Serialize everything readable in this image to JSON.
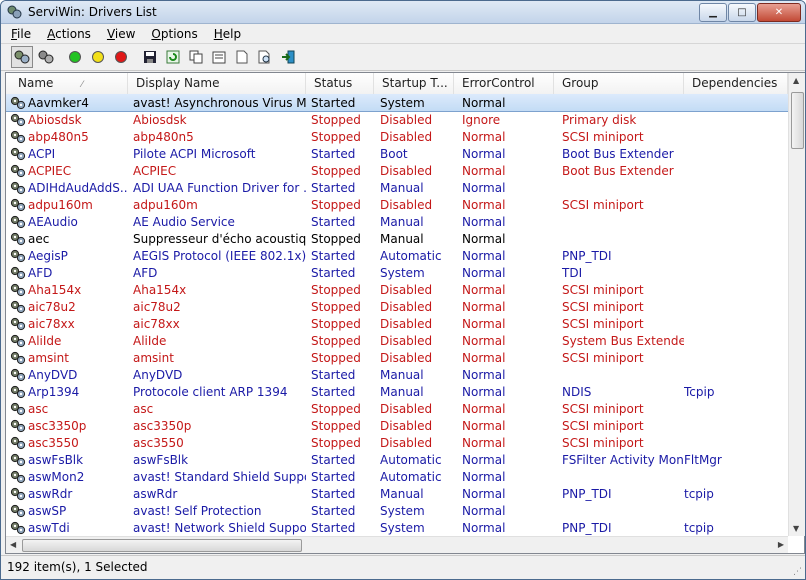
{
  "window": {
    "title": "ServiWin: Drivers List"
  },
  "menu": [
    {
      "label": "File",
      "key": "F",
      "rest": "ile"
    },
    {
      "label": "Actions",
      "key": "A",
      "rest": "ctions"
    },
    {
      "label": "View",
      "key": "V",
      "rest": "iew"
    },
    {
      "label": "Options",
      "key": "O",
      "rest": "ptions"
    },
    {
      "label": "Help",
      "key": "H",
      "rest": "elp"
    }
  ],
  "toolbar": [
    "drivers-icon",
    "services-icon",
    "start-icon",
    "pause-icon",
    "stop-icon",
    "save-icon",
    "refresh-icon",
    "copy-icon",
    "properties-icon",
    "html-report-icon",
    "find-icon",
    "exit-icon"
  ],
  "columns": [
    "Name",
    "Display Name",
    "Status",
    "Startup T...",
    "ErrorControl",
    "Group",
    "Dependencies"
  ],
  "rows": [
    [
      "Aavmker4",
      "avast! Asynchronous Virus Mo...",
      "Started",
      "System",
      "Normal",
      "",
      ""
    ],
    [
      "Abiosdsk",
      "Abiosdsk",
      "Stopped",
      "Disabled",
      "Ignore",
      "Primary disk",
      ""
    ],
    [
      "abp480n5",
      "abp480n5",
      "Stopped",
      "Disabled",
      "Normal",
      "SCSI miniport",
      ""
    ],
    [
      "ACPI",
      "Pilote ACPI Microsoft",
      "Started",
      "Boot",
      "Normal",
      "Boot Bus Extender",
      ""
    ],
    [
      "ACPIEC",
      "ACPIEC",
      "Stopped",
      "Disabled",
      "Normal",
      "Boot Bus Extender",
      ""
    ],
    [
      "ADIHdAudAddS...",
      "ADI UAA Function Driver for ...",
      "Started",
      "Manual",
      "Normal",
      "",
      ""
    ],
    [
      "adpu160m",
      "adpu160m",
      "Stopped",
      "Disabled",
      "Normal",
      "SCSI miniport",
      ""
    ],
    [
      "AEAudio",
      "AE Audio Service",
      "Started",
      "Manual",
      "Normal",
      "",
      ""
    ],
    [
      "aec",
      "Suppresseur d'écho acoustiqu...",
      "Stopped",
      "Manual",
      "Normal",
      "",
      ""
    ],
    [
      "AegisP",
      "AEGIS Protocol (IEEE 802.1x) v...",
      "Started",
      "Automatic",
      "Normal",
      "PNP_TDI",
      ""
    ],
    [
      "AFD",
      "AFD",
      "Started",
      "System",
      "Normal",
      "TDI",
      ""
    ],
    [
      "Aha154x",
      "Aha154x",
      "Stopped",
      "Disabled",
      "Normal",
      "SCSI miniport",
      ""
    ],
    [
      "aic78u2",
      "aic78u2",
      "Stopped",
      "Disabled",
      "Normal",
      "SCSI miniport",
      ""
    ],
    [
      "aic78xx",
      "aic78xx",
      "Stopped",
      "Disabled",
      "Normal",
      "SCSI miniport",
      ""
    ],
    [
      "AliIde",
      "AliIde",
      "Stopped",
      "Disabled",
      "Normal",
      "System Bus Extender",
      ""
    ],
    [
      "amsint",
      "amsint",
      "Stopped",
      "Disabled",
      "Normal",
      "SCSI miniport",
      ""
    ],
    [
      "AnyDVD",
      "AnyDVD",
      "Started",
      "Manual",
      "Normal",
      "",
      ""
    ],
    [
      "Arp1394",
      "Protocole client ARP 1394",
      "Started",
      "Manual",
      "Normal",
      "NDIS",
      "Tcpip"
    ],
    [
      "asc",
      "asc",
      "Stopped",
      "Disabled",
      "Normal",
      "SCSI miniport",
      ""
    ],
    [
      "asc3350p",
      "asc3350p",
      "Stopped",
      "Disabled",
      "Normal",
      "SCSI miniport",
      ""
    ],
    [
      "asc3550",
      "asc3550",
      "Stopped",
      "Disabled",
      "Normal",
      "SCSI miniport",
      ""
    ],
    [
      "aswFsBlk",
      "aswFsBlk",
      "Started",
      "Automatic",
      "Normal",
      "FSFilter Activity Mon...",
      "FltMgr"
    ],
    [
      "aswMon2",
      "avast! Standard Shield Support",
      "Started",
      "Automatic",
      "Normal",
      "",
      ""
    ],
    [
      "aswRdr",
      "aswRdr",
      "Started",
      "Manual",
      "Normal",
      "PNP_TDI",
      "tcpip"
    ],
    [
      "aswSP",
      "avast! Self Protection",
      "Started",
      "System",
      "Normal",
      "",
      ""
    ],
    [
      "aswTdi",
      "avast! Network Shield Support",
      "Started",
      "System",
      "Normal",
      "PNP_TDI",
      "tcpip"
    ]
  ],
  "row_colors": [
    "black",
    "red",
    "red",
    "blue",
    "red",
    "blue",
    "red",
    "blue",
    "black",
    "blue",
    "blue",
    "red",
    "red",
    "red",
    "red",
    "red",
    "blue",
    "blue",
    "red",
    "red",
    "red",
    "blue",
    "blue",
    "blue",
    "blue",
    "blue"
  ],
  "selected_row": 0,
  "status": {
    "text": "192 item(s), 1 Selected"
  },
  "colors": {
    "started": "#1a1aa6",
    "stopped": "#c41818",
    "selection": "#c3dcf5"
  }
}
